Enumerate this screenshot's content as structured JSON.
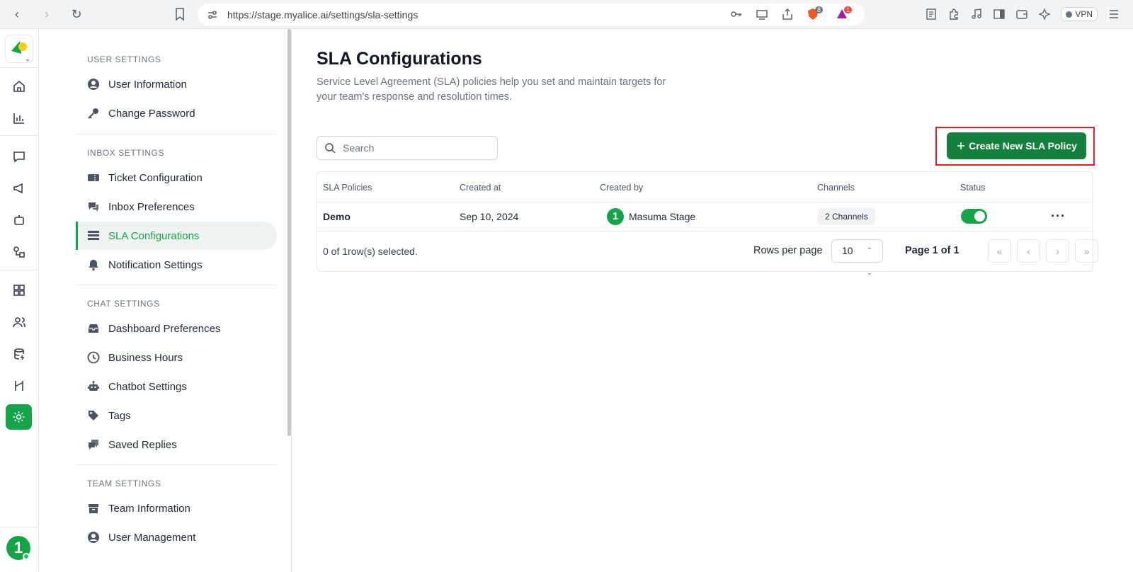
{
  "browser": {
    "url": "https://stage.myalice.ai/settings/sla-settings",
    "vpn_label": "VPN",
    "brave_badge": "8",
    "alert_badge": "1"
  },
  "rail": {
    "avatar_initial": "1"
  },
  "sidebar": {
    "sections": [
      {
        "title": "USER SETTINGS",
        "items": [
          {
            "label": "User Information",
            "icon": "user-circle-icon"
          },
          {
            "label": "Change Password",
            "icon": "key-icon"
          }
        ]
      },
      {
        "title": "INBOX SETTINGS",
        "items": [
          {
            "label": "Ticket Configuration",
            "icon": "ticket-icon"
          },
          {
            "label": "Inbox Preferences",
            "icon": "chat-bubbles-icon"
          },
          {
            "label": "SLA Configurations",
            "icon": "list-icon",
            "active": true
          },
          {
            "label": "Notification Settings",
            "icon": "bell-icon"
          }
        ]
      },
      {
        "title": "CHAT SETTINGS",
        "items": [
          {
            "label": "Dashboard Preferences",
            "icon": "inbox-tray-icon"
          },
          {
            "label": "Business Hours",
            "icon": "clock-icon"
          },
          {
            "label": "Chatbot Settings",
            "icon": "robot-icon"
          },
          {
            "label": "Tags",
            "icon": "tag-icon"
          },
          {
            "label": "Saved Replies",
            "icon": "saved-replies-icon"
          }
        ]
      },
      {
        "title": "TEAM SETTINGS",
        "items": [
          {
            "label": "Team Information",
            "icon": "archive-icon"
          },
          {
            "label": "User Management",
            "icon": "user-circle-icon"
          }
        ]
      }
    ]
  },
  "main": {
    "title": "SLA Configurations",
    "description": "Service Level Agreement (SLA) policies help you set and maintain targets for your team's response and resolution times.",
    "search_placeholder": "Search",
    "create_button": "Create New SLA Policy",
    "table": {
      "columns": [
        "SLA Policies",
        "Created at",
        "Created by",
        "Channels",
        "Status"
      ],
      "rows": [
        {
          "policy": "Demo",
          "created_at": "Sep 10, 2024",
          "creator_initial": "1",
          "created_by": "Masuma Stage",
          "channels": "2 Channels",
          "status_on": true
        }
      ],
      "selection_text": "0 of 1row(s) selected.",
      "rows_per_page_label": "Rows per page",
      "rows_per_page_value": "10",
      "page_label": "Page 1 of 1"
    }
  },
  "colors": {
    "brand_green": "#16a34a",
    "button_green": "#15803d",
    "highlight_red": "#e11d2a"
  }
}
